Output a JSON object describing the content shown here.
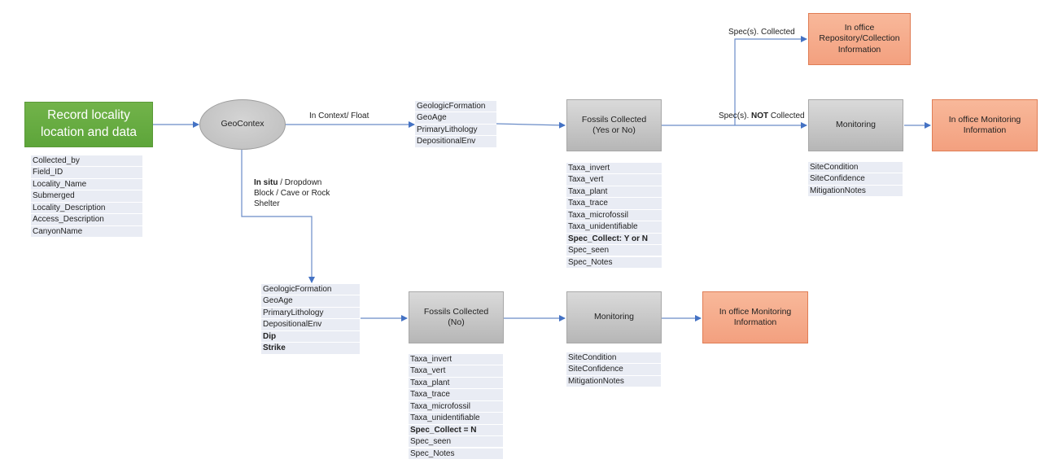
{
  "diagram": {
    "start_node": {
      "label_line1": "Record locality",
      "label_line2": "location and data",
      "color": "#6aaf44"
    },
    "start_fields": [
      "Collected_by",
      "Field_ID",
      "Locality_Name",
      "Submerged",
      "Locality_Description",
      "Access_Description",
      "CanyonName"
    ],
    "decision_node": {
      "label": "GeoContex",
      "color": "#c8c8c8"
    },
    "branch_float": {
      "edge_label": "In Context/ Float",
      "geo_fields": [
        "GeologicFormation",
        "GeoAge",
        "PrimaryLithology",
        "DepositionalEnv"
      ],
      "fossils_node": {
        "label_line1": "Fossils Collected",
        "label_line2": "(Yes or No)"
      },
      "fossil_fields": [
        {
          "text": "Taxa_invert",
          "bold": false
        },
        {
          "text": "Taxa_vert",
          "bold": false
        },
        {
          "text": "Taxa_plant",
          "bold": false
        },
        {
          "text": "Taxa_trace",
          "bold": false
        },
        {
          "text": "Taxa_microfossil",
          "bold": false
        },
        {
          "text": "Taxa_unidentifiable",
          "bold": false
        },
        {
          "text": "Spec_Collect: Y or N",
          "bold": true
        },
        {
          "text": "Spec_seen",
          "bold": false
        },
        {
          "text": "Spec_Notes",
          "bold": false
        }
      ],
      "collected_edge_label": "Spec(s). Collected",
      "repository_node": {
        "label_line1": "In office",
        "label_line2": "Repository/Collection",
        "label_line3": "Information"
      },
      "not_collected_edge_label": {
        "prefix": "Spec(s). ",
        "bold": "NOT",
        "suffix": " Collected"
      },
      "monitoring_node": {
        "label": "Monitoring"
      },
      "monitoring_fields": [
        "SiteCondition",
        "SiteConfidence",
        "MitigationNotes"
      ],
      "office_monitoring_node": {
        "label_line1": "In office Monitoring",
        "label_line2": "Information"
      }
    },
    "branch_insitu": {
      "edge_label": {
        "bold": "In situ",
        "line1_rest": " / Dropdown",
        "line2": "Block / Cave or Rock",
        "line3": "Shelter"
      },
      "geo_fields": [
        {
          "text": "GeologicFormation",
          "bold": false
        },
        {
          "text": "GeoAge",
          "bold": false
        },
        {
          "text": "PrimaryLithology",
          "bold": false
        },
        {
          "text": "DepositionalEnv",
          "bold": false
        },
        {
          "text": "Dip",
          "bold": true
        },
        {
          "text": "Strike",
          "bold": true
        }
      ],
      "fossils_node": {
        "label_line1": "Fossils Collected",
        "label_line2": "(No)"
      },
      "fossil_fields": [
        {
          "text": "Taxa_invert",
          "bold": false
        },
        {
          "text": "Taxa_vert",
          "bold": false
        },
        {
          "text": "Taxa_plant",
          "bold": false
        },
        {
          "text": "Taxa_trace",
          "bold": false
        },
        {
          "text": "Taxa_microfossil",
          "bold": false
        },
        {
          "text": "Taxa_unidentifiable",
          "bold": false
        },
        {
          "text": "Spec_Collect = N",
          "bold": true
        },
        {
          "text": "Spec_seen",
          "bold": false
        },
        {
          "text": "Spec_Notes",
          "bold": false
        }
      ],
      "monitoring_node": {
        "label": "Monitoring"
      },
      "monitoring_fields": [
        "SiteCondition",
        "SiteConfidence",
        "MitigationNotes"
      ],
      "office_monitoring_node": {
        "label_line1": "In office Monitoring",
        "label_line2": "Information"
      }
    },
    "colors": {
      "connector": "#5b7fbf",
      "arrowhead": "#4472c4",
      "field_bg": "#e9ecf4",
      "process_gray": "#c4c4c4",
      "office_orange": "#f5aa88"
    }
  }
}
